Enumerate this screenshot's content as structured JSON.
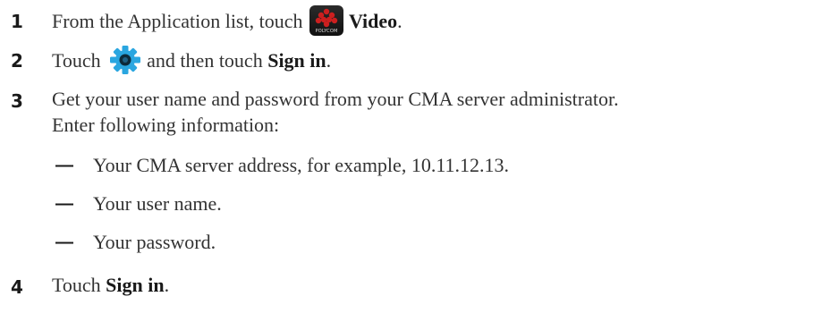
{
  "steps": [
    {
      "number": "1",
      "text_before": "From the Application list, touch",
      "bold": "Video",
      "text_after": "."
    },
    {
      "number": "2",
      "text_before": "Touch",
      "text_middle": "and then touch",
      "bold": "Sign in",
      "text_after": "."
    },
    {
      "number": "3",
      "line1": "Get your user name and password from your CMA server administrator.",
      "line2": "Enter following information:"
    },
    {
      "number": "4",
      "text_before": "Touch",
      "bold": "Sign in",
      "text_after": "."
    }
  ],
  "bullets": [
    {
      "marker": "—",
      "text": "Your CMA server address, for example, 10.11.12.13."
    },
    {
      "marker": "—",
      "text": "Your user name."
    },
    {
      "marker": "—",
      "text": "Your password."
    }
  ],
  "icons": {
    "video_app": {
      "name": "polycom-video-app-icon",
      "label": "POLYCOM",
      "color": "#cc1f1f"
    },
    "settings": {
      "name": "settings-gear-icon",
      "color": "#2aa6e0"
    }
  }
}
